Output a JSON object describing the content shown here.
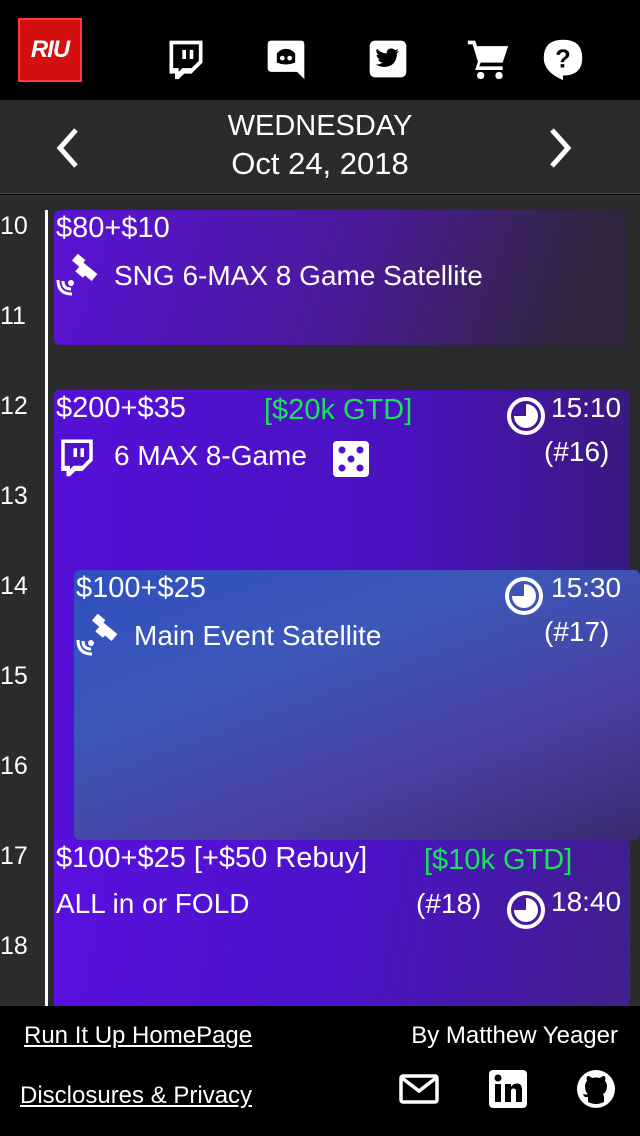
{
  "app": {
    "logo_text": "RIU"
  },
  "nav": {
    "icons": [
      "twitch-icon",
      "discord-icon",
      "twitter-icon",
      "cart-icon",
      "help-icon"
    ]
  },
  "date_header": {
    "day": "WEDNESDAY",
    "date": "Oct 24, 2018"
  },
  "hours": [
    "10",
    "11",
    "12",
    "13",
    "14",
    "15",
    "16",
    "17",
    "18"
  ],
  "events": [
    {
      "buyin": "$80+$10",
      "title": "SNG 6-MAX 8 Game Satellite",
      "icon": "satellite-icon"
    },
    {
      "buyin": "$200+$35",
      "guarantee": "[$20k GTD]",
      "time": "15:10",
      "number": "(#16)",
      "title": "6 MAX 8-Game",
      "icon": "twitch-icon",
      "extra_icon": "dice-icon"
    },
    {
      "buyin": "$100+$25",
      "time": "15:30",
      "number": "(#17)",
      "title": "Main Event Satellite",
      "icon": "satellite-icon"
    },
    {
      "buyin": "$100+$25 [+$50 Rebuy]",
      "guarantee": "[$10k GTD]",
      "time": "18:40",
      "number": "(#18)",
      "title": "ALL in or FOLD"
    }
  ],
  "footer": {
    "homepage_link": "Run It Up HomePage",
    "privacy_link": "Disclosures & Privacy",
    "author": "By Matthew Yeager",
    "icons": [
      "mail-icon",
      "linkedin-icon",
      "github-icon"
    ]
  },
  "colors": {
    "accent_green": "#19e35a",
    "event_purple": "#5510d8",
    "logo_red": "#d30f0f",
    "background": "#2b2b2e"
  }
}
